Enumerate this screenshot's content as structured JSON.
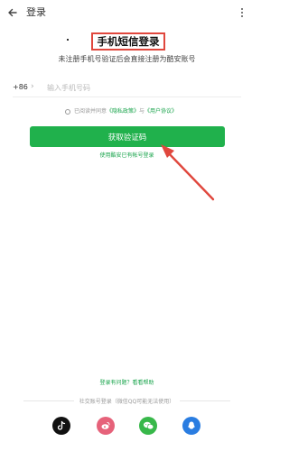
{
  "topbar": {
    "title": "登录"
  },
  "heading": {
    "title": "手机短信登录",
    "subtitle": "未注册手机号验证后会直接注册为酷安账号"
  },
  "phone": {
    "country_code": "+86",
    "chevron": "›",
    "placeholder": "输入手机号码"
  },
  "agreement": {
    "prefix": "已阅读并同意",
    "privacy": "《隐私政策》",
    "and": "与",
    "user": "《用户协议》"
  },
  "actions": {
    "get_code": "获取验证码",
    "alt_login": "使用酷安已有帐号登录"
  },
  "footer": {
    "help": "登录有问题？看看帮助",
    "social_label": "社交账号登录（微信QQ可能无法使用）"
  },
  "social": [
    {
      "icon": "tiktok-icon",
      "color": "#111111"
    },
    {
      "icon": "weibo-icon",
      "color": "#e6627a"
    },
    {
      "icon": "wechat-icon",
      "color": "#38b84a"
    },
    {
      "icon": "qq-icon",
      "color": "#2a7de1"
    }
  ],
  "colors": {
    "accent": "#20b14c",
    "link": "#17a34a",
    "annotation": "#e0473d"
  }
}
